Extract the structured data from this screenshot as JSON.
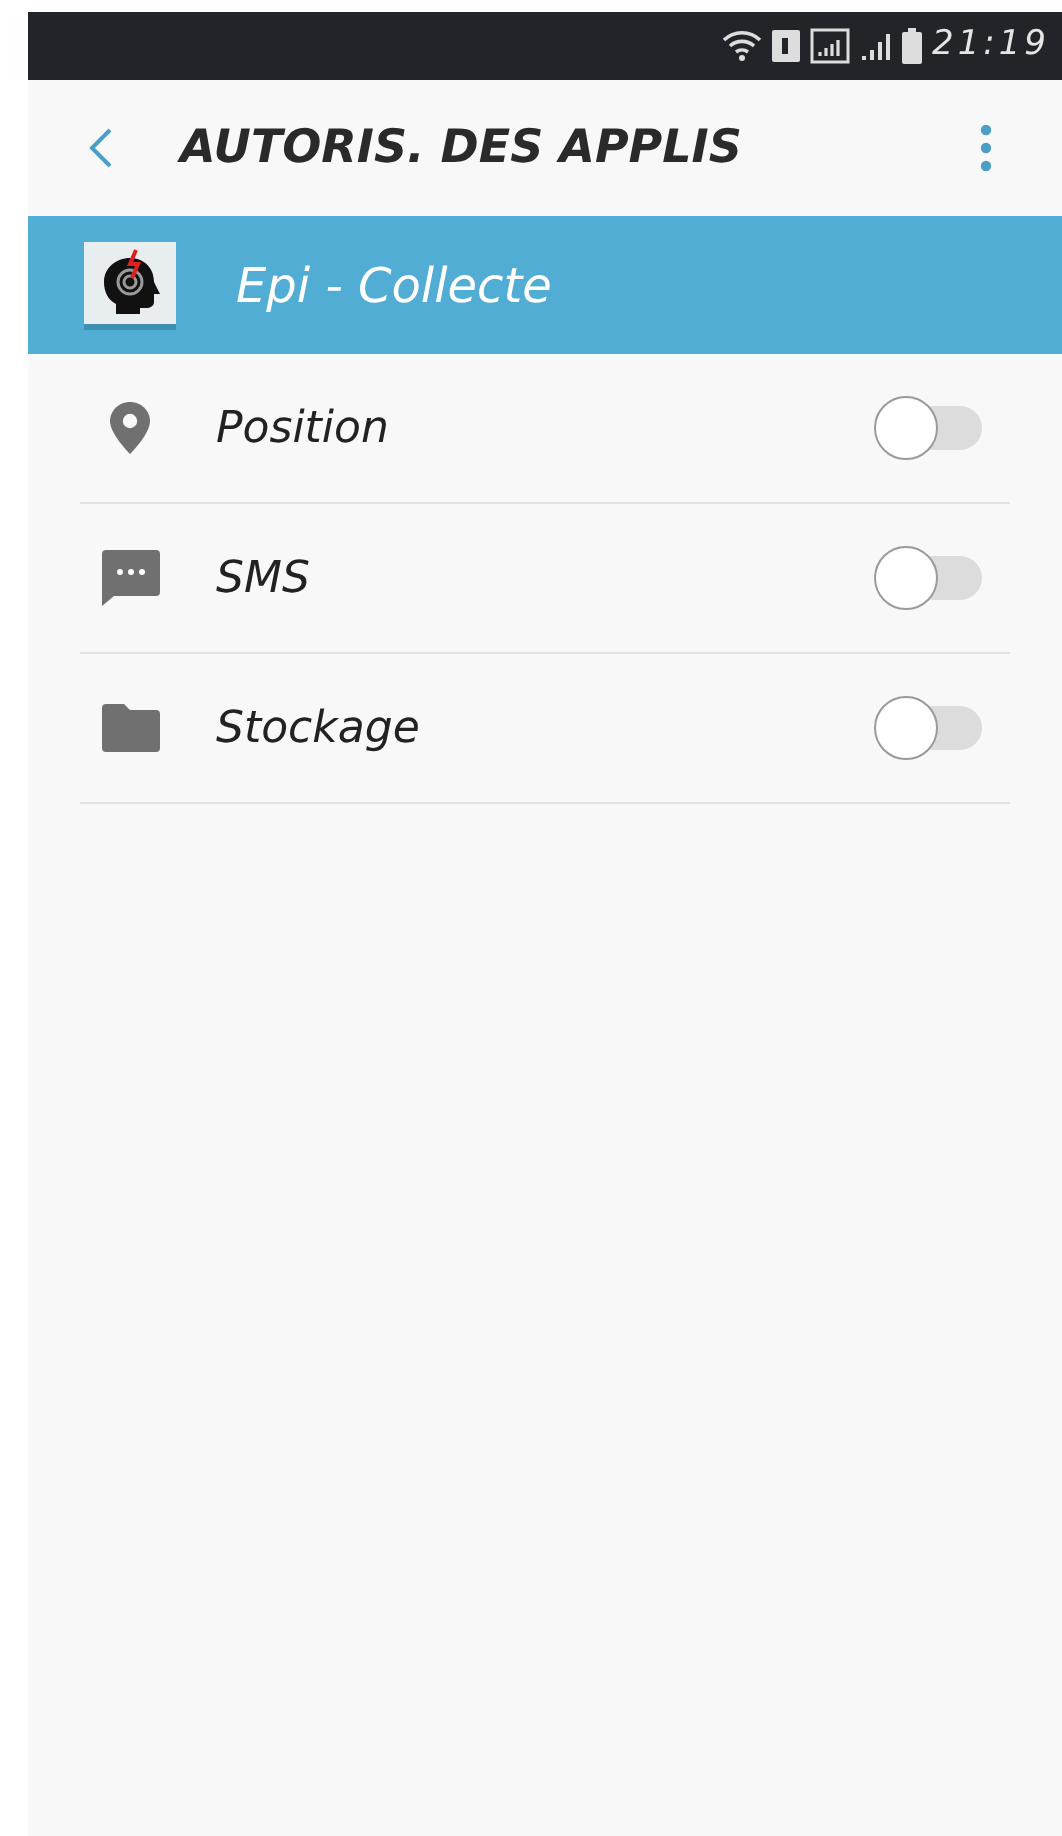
{
  "status_bar": {
    "time": "21:19"
  },
  "header": {
    "title": "AUTORIS. DES APPLIS"
  },
  "app": {
    "name": "Epi - Collecte"
  },
  "permissions": [
    {
      "kind": "location",
      "label": "Position",
      "on": false
    },
    {
      "kind": "message",
      "label": "SMS",
      "on": false
    },
    {
      "kind": "folder",
      "label": "Stockage",
      "on": false
    }
  ]
}
